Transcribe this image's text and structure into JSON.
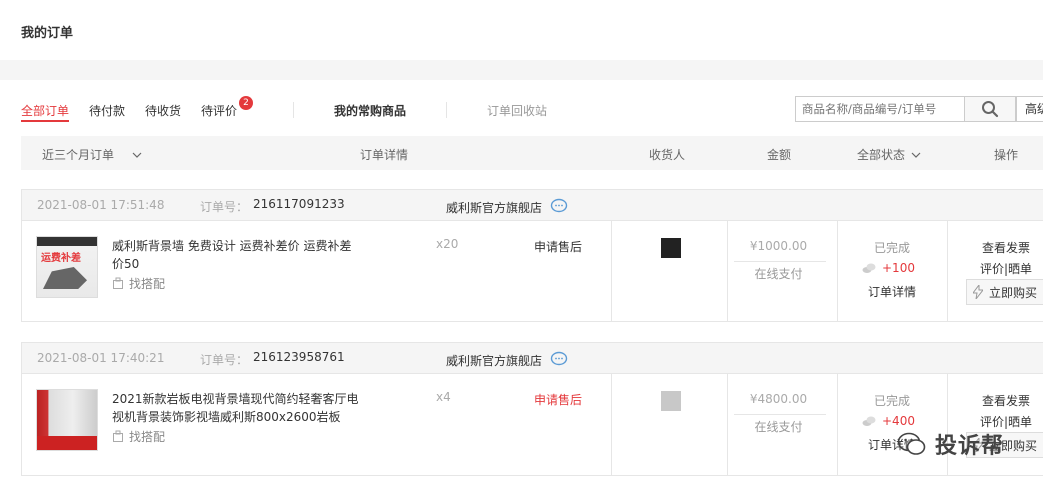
{
  "header": {
    "title": "我的订单"
  },
  "tabs": [
    {
      "label": "全部订单"
    },
    {
      "label": "待付款"
    },
    {
      "label": "待收货"
    },
    {
      "label": "待评价",
      "badge": "2"
    }
  ],
  "extra_tabs": {
    "frequent": "我的常购商品",
    "recycle": "订单回收站"
  },
  "search": {
    "placeholder": "商品名称/商品编号/订单号",
    "advanced_label": "高级"
  },
  "table_header": {
    "range": "近三个月订单",
    "details": "订单详情",
    "receiver": "收货人",
    "amount": "金额",
    "status": "全部状态",
    "ops": "操作"
  },
  "orders": [
    {
      "date": "2021-08-01 17:51:48",
      "order_no_label": "订单号：",
      "order_no": "216117091233",
      "shop": "威利斯官方旗舰店",
      "product_name": "威利斯背景墙 免费设计 运费补差价 运费补差价50",
      "thumb_text": "运费补差",
      "match_label": "找搭配",
      "qty": "x20",
      "after_sale": "申请售后",
      "amount": "¥1000.00",
      "payment": "在线支付",
      "status": "已完成",
      "points": "+100",
      "detail": "订单详情",
      "op_invoice": "查看发票",
      "op_review": "评价|晒单",
      "op_buy": "立即购买"
    },
    {
      "date": "2021-08-01 17:40:21",
      "order_no_label": "订单号：",
      "order_no": "216123958761",
      "shop": "威利斯官方旗舰店",
      "product_name": "2021新款岩板电视背景墙现代简约轻奢客厅电视机背景装饰影视墙威利斯800x2600岩板",
      "match_label": "找搭配",
      "qty": "x4",
      "after_sale": "申请售后",
      "amount": "¥4800.00",
      "payment": "在线支付",
      "status": "已完成",
      "points": "+400",
      "detail": "订单详情",
      "op_invoice": "查看发票",
      "op_review": "评价|晒单",
      "op_buy": "立即购买"
    }
  ],
  "watermark": {
    "text": "投诉帮"
  },
  "colors": {
    "accent": "#e4393c",
    "border": "#e6e6e6",
    "muted": "#999999"
  }
}
